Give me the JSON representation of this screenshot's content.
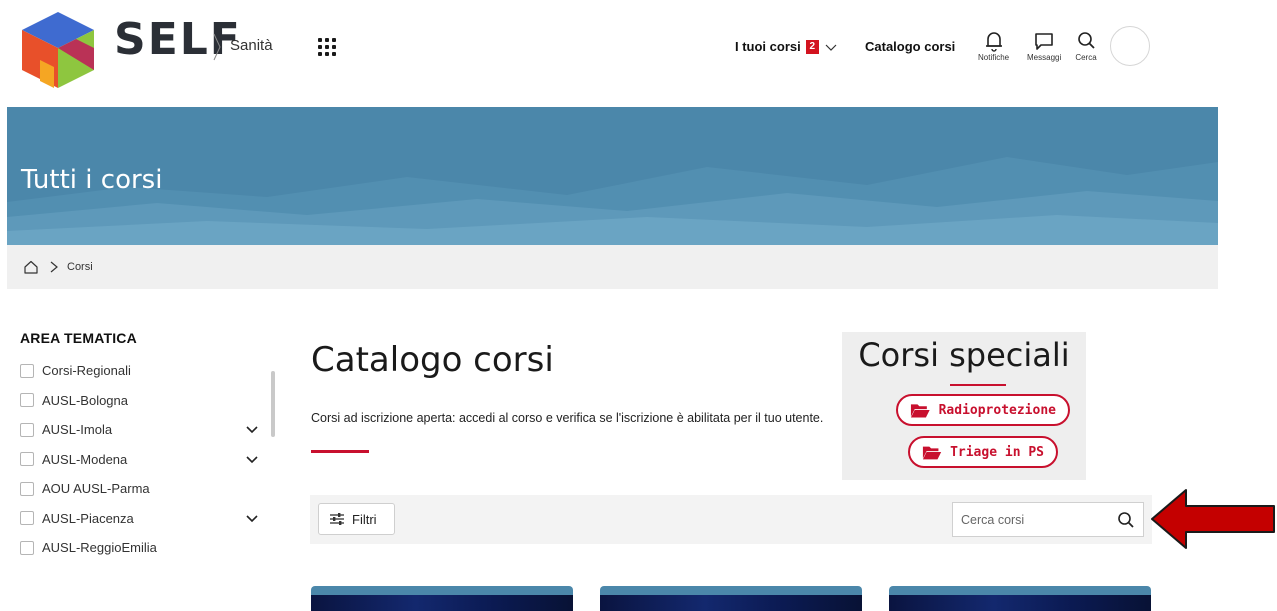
{
  "header": {
    "brand": "SELF",
    "brand_sub": "Sanità",
    "nav_courses_label": "I tuoi corsi",
    "nav_courses_badge": "2",
    "nav_catalog_label": "Catalogo corsi",
    "icons": [
      {
        "name": "bell-icon",
        "label": "Notifiche"
      },
      {
        "name": "chat-icon",
        "label": "Messaggi"
      },
      {
        "name": "search-icon",
        "label": "Cerca"
      }
    ]
  },
  "hero": {
    "title": "Tutti i corsi"
  },
  "breadcrumb": {
    "items": [
      "Corsi"
    ]
  },
  "sidebar": {
    "title": "AREA TEMATICA",
    "items": [
      {
        "label": "Corsi-Regionali",
        "expandable": false
      },
      {
        "label": "AUSL-Bologna",
        "expandable": false
      },
      {
        "label": "AUSL-Imola",
        "expandable": true
      },
      {
        "label": "AUSL-Modena",
        "expandable": true
      },
      {
        "label": "AOU AUSL-Parma",
        "expandable": false
      },
      {
        "label": "AUSL-Piacenza",
        "expandable": true
      },
      {
        "label": "AUSL-ReggioEmilia",
        "expandable": false
      }
    ]
  },
  "main": {
    "title": "Catalogo corsi",
    "description": "Corsi ad iscrizione aperta: accedi al corso e verifica se l'iscrizione è abilitata per il tuo utente."
  },
  "special": {
    "title": "Corsi speciali",
    "buttons": [
      "Radioprotezione",
      "Triage in PS"
    ]
  },
  "filters": {
    "button_label": "Filtri",
    "search_placeholder": "Cerca corsi"
  },
  "colors": {
    "accent_red": "#c8102e",
    "hero_blue": "#4b87aa",
    "badge_red": "#d3131f"
  }
}
